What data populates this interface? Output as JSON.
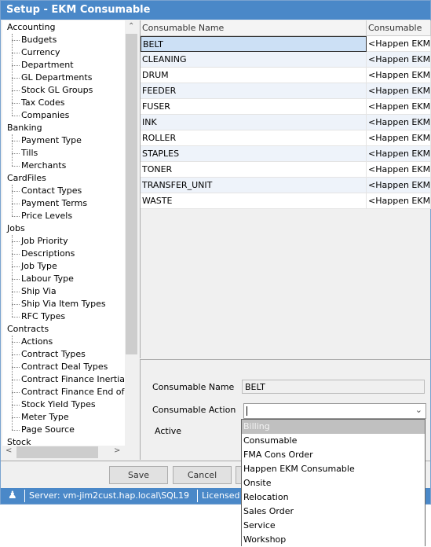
{
  "window": {
    "title": "Setup - EKM Consumable"
  },
  "tree": [
    {
      "label": "Accounting",
      "children": [
        "Budgets",
        "Currency",
        "Department",
        "GL Departments",
        "Stock GL Groups",
        "Tax Codes",
        "Companies"
      ]
    },
    {
      "label": "Banking",
      "children": [
        "Payment Type",
        "Tills",
        "Merchants"
      ]
    },
    {
      "label": "CardFiles",
      "children": [
        "Contact Types",
        "Payment Terms",
        "Price Levels"
      ]
    },
    {
      "label": "Jobs",
      "children": [
        "Job Priority",
        "Descriptions",
        "Job Type",
        "Labour Type",
        "Ship Via",
        "Ship Via Item Types",
        "RFC Types"
      ]
    },
    {
      "label": "Contracts",
      "children": [
        "Actions",
        "Contract Types",
        "Contract Deal Types",
        "Contract Finance Inertia",
        "Contract Finance End of Te",
        "Stock Yield Types",
        "Meter Type",
        "Page Source"
      ]
    },
    {
      "label": "Stock",
      "children": []
    }
  ],
  "grid": {
    "columns": [
      "Consumable Name",
      "Consumable Acti"
    ],
    "rows": [
      {
        "name": "BELT",
        "action": "<Happen EKM Co"
      },
      {
        "name": "CLEANING",
        "action": "<Happen EKM Co"
      },
      {
        "name": "DRUM",
        "action": "<Happen EKM Co"
      },
      {
        "name": "FEEDER",
        "action": "<Happen EKM Co"
      },
      {
        "name": "FUSER",
        "action": "<Happen EKM Co"
      },
      {
        "name": "INK",
        "action": "<Happen EKM Co"
      },
      {
        "name": "ROLLER",
        "action": "<Happen EKM Co"
      },
      {
        "name": "STAPLES",
        "action": "<Happen EKM Co"
      },
      {
        "name": "TONER",
        "action": "<Happen EKM Co"
      },
      {
        "name": "TRANSFER_UNIT",
        "action": "<Happen EKM Co"
      },
      {
        "name": "WASTE",
        "action": "<Happen EKM Co"
      }
    ]
  },
  "detail": {
    "name_label": "Consumable Name",
    "name_value": "BELT",
    "action_label": "Consumable Action",
    "action_value": "",
    "active_label": "Active"
  },
  "dropdown": {
    "options": [
      "Billing",
      "Consumable",
      "FMA Cons Order",
      "Happen EKM Consumable",
      "Onsite",
      "Relocation",
      "Sales Order",
      "Service",
      "Workshop"
    ],
    "highlighted": "Billing"
  },
  "buttons": {
    "save": "Save",
    "cancel": "Cancel"
  },
  "status": {
    "server": "Server: vm-jim2cust.hap.local\\SQL19",
    "licensed": "Licensed to"
  }
}
